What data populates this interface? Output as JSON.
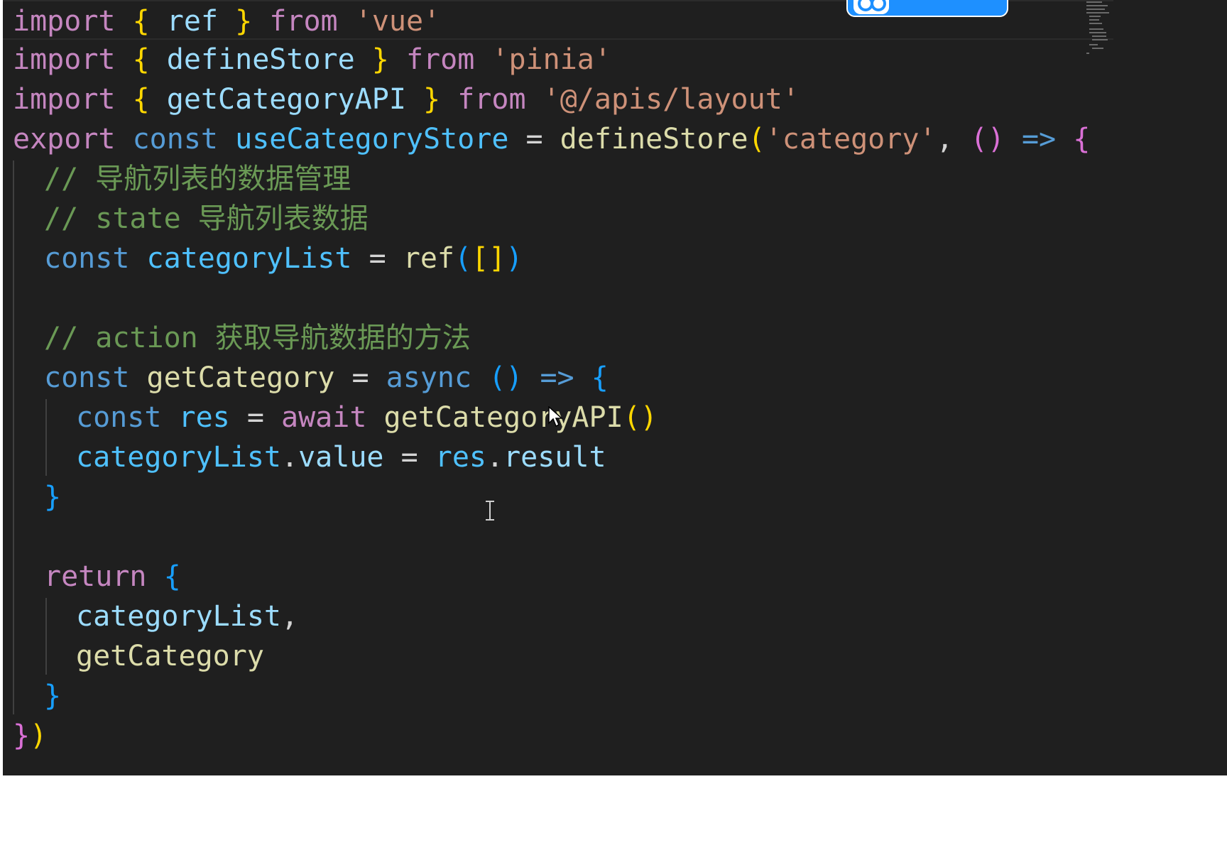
{
  "editor": {
    "language": "javascript",
    "lines": [
      {
        "tokens": [
          [
            "import",
            "kw-ctrl"
          ],
          [
            " ",
            "op"
          ],
          [
            "{",
            "b1"
          ],
          [
            " ",
            "op"
          ],
          [
            "ref",
            "var"
          ],
          [
            " ",
            "op"
          ],
          [
            "}",
            "b1"
          ],
          [
            " ",
            "op"
          ],
          [
            "from",
            "kw-ctrl"
          ],
          [
            " ",
            "op"
          ],
          [
            "'vue'",
            "str"
          ]
        ]
      },
      {
        "tokens": [
          [
            "import",
            "kw-ctrl"
          ],
          [
            " ",
            "op"
          ],
          [
            "{",
            "b1"
          ],
          [
            " ",
            "op"
          ],
          [
            "defineStore",
            "var"
          ],
          [
            " ",
            "op"
          ],
          [
            "}",
            "b1"
          ],
          [
            " ",
            "op"
          ],
          [
            "from",
            "kw-ctrl"
          ],
          [
            " ",
            "op"
          ],
          [
            "'pinia'",
            "str"
          ]
        ]
      },
      {
        "tokens": [
          [
            "import",
            "kw-ctrl"
          ],
          [
            " ",
            "op"
          ],
          [
            "{",
            "b1"
          ],
          [
            " ",
            "op"
          ],
          [
            "getCategoryAPI",
            "var"
          ],
          [
            " ",
            "op"
          ],
          [
            "}",
            "b1"
          ],
          [
            " ",
            "op"
          ],
          [
            "from",
            "kw-ctrl"
          ],
          [
            " ",
            "op"
          ],
          [
            "'@/apis/layout'",
            "str"
          ]
        ]
      },
      {
        "tokens": [
          [
            "export",
            "kw-ctrl"
          ],
          [
            " ",
            "op"
          ],
          [
            "const",
            "kw-decl"
          ],
          [
            " ",
            "op"
          ],
          [
            "useCategoryStore",
            "const"
          ],
          [
            " = ",
            "op"
          ],
          [
            "defineStore",
            "fn"
          ],
          [
            "(",
            "b1"
          ],
          [
            "'category'",
            "str"
          ],
          [
            ", ",
            "op"
          ],
          [
            "()",
            "b2"
          ],
          [
            " ",
            "op"
          ],
          [
            "=>",
            "kw-decl"
          ],
          [
            " ",
            "op"
          ],
          [
            "{",
            "b2"
          ]
        ]
      },
      {
        "tokens": [
          [
            "// 导航列表的数据管理",
            "cmt"
          ]
        ]
      },
      {
        "tokens": [
          [
            "// state 导航列表数据",
            "cmt"
          ]
        ]
      },
      {
        "tokens": [
          [
            "const",
            "kw-decl"
          ],
          [
            " ",
            "op"
          ],
          [
            "categoryList",
            "const"
          ],
          [
            " = ",
            "op"
          ],
          [
            "ref",
            "fn"
          ],
          [
            "(",
            "b3"
          ],
          [
            "[]",
            "b1"
          ],
          [
            ")",
            "b3"
          ]
        ]
      },
      {
        "tokens": []
      },
      {
        "tokens": [
          [
            "// action 获取导航数据的方法",
            "cmt"
          ]
        ]
      },
      {
        "tokens": [
          [
            "const",
            "kw-decl"
          ],
          [
            " ",
            "op"
          ],
          [
            "getCategory",
            "fn"
          ],
          [
            " = ",
            "op"
          ],
          [
            "async",
            "kw-decl"
          ],
          [
            " ",
            "op"
          ],
          [
            "()",
            "b3"
          ],
          [
            " ",
            "op"
          ],
          [
            "=>",
            "kw-decl"
          ],
          [
            " ",
            "op"
          ],
          [
            "{",
            "b3"
          ]
        ]
      },
      {
        "tokens": [
          [
            "const",
            "kw-decl"
          ],
          [
            " ",
            "op"
          ],
          [
            "res",
            "const"
          ],
          [
            " = ",
            "op"
          ],
          [
            "await",
            "kw-ctrl"
          ],
          [
            " ",
            "op"
          ],
          [
            "getCategoryAPI",
            "fn"
          ],
          [
            "()",
            "b1"
          ]
        ]
      },
      {
        "tokens": [
          [
            "categoryList",
            "const"
          ],
          [
            ".",
            "op"
          ],
          [
            "value",
            "var"
          ],
          [
            " = ",
            "op"
          ],
          [
            "res",
            "const"
          ],
          [
            ".",
            "op"
          ],
          [
            "result",
            "var"
          ]
        ]
      },
      {
        "tokens": [
          [
            "}",
            "b3"
          ]
        ]
      },
      {
        "tokens": []
      },
      {
        "tokens": [
          [
            "return",
            "kw-ctrl"
          ],
          [
            " ",
            "op"
          ],
          [
            "{",
            "b3"
          ]
        ]
      },
      {
        "tokens": [
          [
            "categoryList",
            "var"
          ],
          [
            ",",
            "op"
          ]
        ]
      },
      {
        "tokens": [
          [
            "getCategory",
            "fn"
          ]
        ]
      },
      {
        "tokens": [
          [
            "}",
            "b3"
          ]
        ]
      },
      {
        "tokens": [
          [
            "}",
            "b2"
          ],
          [
            ")",
            "b1"
          ]
        ]
      }
    ],
    "indents": [
      0,
      0,
      0,
      0,
      1,
      1,
      1,
      0,
      1,
      1,
      2,
      2,
      1,
      0,
      1,
      2,
      2,
      1,
      0
    ]
  },
  "overlay_button": {
    "icon": "infinity-icon"
  },
  "cursors": {
    "pointer": "mouse-pointer-icon",
    "text": "text-cursor-icon"
  }
}
